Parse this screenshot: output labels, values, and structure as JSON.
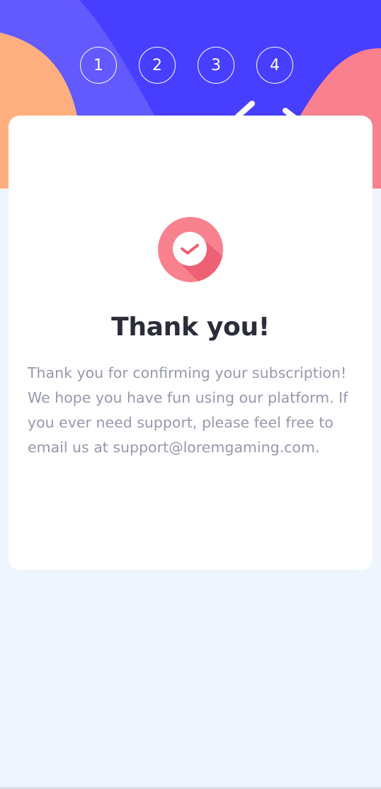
{
  "steps": [
    "1",
    "2",
    "3",
    "4"
  ],
  "confirmation": {
    "icon": "check-icon",
    "title": "Thank you!",
    "message": "Thank you for confirming your subscription! We hope you have fun using our platform. If you ever need support, please feel free to email us at support@loremgaming.com."
  },
  "colors": {
    "hero_background": "#483eff",
    "hero_shape_light": "#6259ff",
    "hero_shape_orange": "#ffaf7e",
    "hero_shape_pink": "#f9818e",
    "page_background": "#eff5ff",
    "title": "#2b2d3a",
    "message": "#9699ab",
    "icon_primary": "#f9818e",
    "icon_shadow": "#ee6174"
  }
}
